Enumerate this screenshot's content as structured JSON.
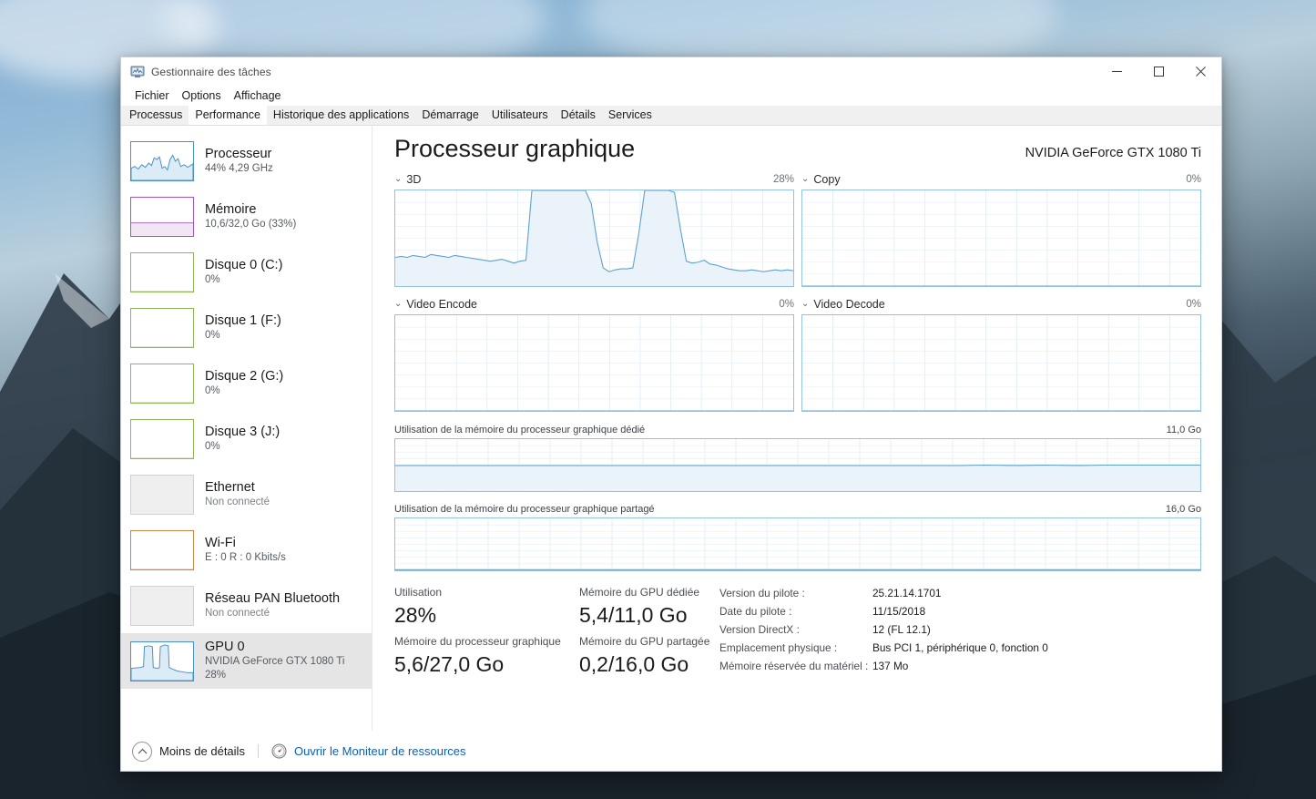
{
  "window": {
    "title": "Gestionnaire des tâches",
    "icon": "task-manager-icon",
    "minimize": "—",
    "maximize": "□",
    "close": "✕"
  },
  "menu": {
    "items": [
      "Fichier",
      "Options",
      "Affichage"
    ]
  },
  "tabs": {
    "items": [
      {
        "label": "Processus",
        "active": false
      },
      {
        "label": "Performance",
        "active": true
      },
      {
        "label": "Historique des applications",
        "active": false
      },
      {
        "label": "Démarrage",
        "active": false
      },
      {
        "label": "Utilisateurs",
        "active": false
      },
      {
        "label": "Détails",
        "active": false
      },
      {
        "label": "Services",
        "active": false
      }
    ]
  },
  "sidebar": {
    "items": [
      {
        "title": "Processeur",
        "sub": "44%  4,29 GHz",
        "accent": "#4a90c4",
        "fill": "#dcecf7",
        "type": "cpu",
        "selected": false,
        "empty": false
      },
      {
        "title": "Mémoire",
        "sub": "10,6/32,0 Go (33%)",
        "accent": "#a357b8",
        "fill": "#f0e6f4",
        "type": "mem",
        "selected": false,
        "empty": false
      },
      {
        "title": "Disque 0 (C:)",
        "sub": "0%",
        "accent": "#8cb85a",
        "fill": "#ffffff",
        "type": "disk",
        "selected": false,
        "empty": true
      },
      {
        "title": "Disque 1 (F:)",
        "sub": "0%",
        "accent": "#8cb85a",
        "fill": "#ffffff",
        "type": "disk",
        "selected": false,
        "empty": true
      },
      {
        "title": "Disque 2 (G:)",
        "sub": "0%",
        "accent": "#8cb85a",
        "fill": "#ffffff",
        "type": "disk",
        "selected": false,
        "empty": true
      },
      {
        "title": "Disque 3 (J:)",
        "sub": "0%",
        "accent": "#8cb85a",
        "fill": "#ffffff",
        "type": "disk",
        "selected": false,
        "empty": true
      },
      {
        "title": "Ethernet",
        "sub": "Non connecté",
        "accent": "#d0d0d0",
        "fill": "#efefef",
        "type": "net-off",
        "selected": false,
        "empty": true
      },
      {
        "title": "Wi-Fi",
        "sub": "E : 0  R : 0 Kbits/s",
        "accent": "#c9884a",
        "fill": "#ffffff",
        "type": "net",
        "selected": false,
        "empty": true
      },
      {
        "title": "Réseau PAN Bluetooth",
        "sub": "Non connecté",
        "accent": "#d0d0d0",
        "fill": "#efefef",
        "type": "net-off",
        "selected": false,
        "empty": true
      },
      {
        "title": "GPU 0",
        "sub": "NVIDIA GeForce GTX 1080 Ti",
        "sub2": "28%",
        "accent": "#4a90c4",
        "fill": "#dcecf7",
        "type": "gpu",
        "selected": true,
        "empty": false
      }
    ]
  },
  "main": {
    "title": "Processeur graphique",
    "device": "NVIDIA GeForce GTX 1080 Ti",
    "engines": [
      {
        "name": "3D",
        "value": "28%"
      },
      {
        "name": "Copy",
        "value": "0%"
      },
      {
        "name": "Video Encode",
        "value": "0%"
      },
      {
        "name": "Video Decode",
        "value": "0%"
      }
    ],
    "memory_graphs": [
      {
        "label": "Utilisation de la mémoire du processeur graphique dédié",
        "max": "11,0 Go"
      },
      {
        "label": "Utilisation de la mémoire du processeur graphique partagé",
        "max": "16,0 Go"
      }
    ],
    "stats": [
      {
        "key": "Utilisation",
        "value": "28%"
      },
      {
        "key": "Mémoire du processeur graphique",
        "value": "5,6/27,0 Go"
      },
      {
        "key": "Mémoire du GPU dédiée",
        "value": "5,4/11,0 Go"
      },
      {
        "key": "Mémoire du GPU partagée",
        "value": "0,2/16,0 Go"
      }
    ],
    "info": [
      {
        "key": "Version du pilote :",
        "value": "25.21.14.1701"
      },
      {
        "key": "Date du pilote :",
        "value": "11/15/2018"
      },
      {
        "key": "Version DirectX :",
        "value": "12 (FL 12.1)"
      },
      {
        "key": "Emplacement physique :",
        "value": "Bus PCI 1, périphérique 0, fonction 0"
      },
      {
        "key": "Mémoire réservée du matériel :",
        "value": "137 Mo"
      }
    ]
  },
  "footer": {
    "less_details": "Moins de détails",
    "resource_monitor": "Ouvrir le Moniteur de ressources"
  },
  "chart_data": [
    {
      "type": "area",
      "title": "3D",
      "ylabel": "%",
      "ylim": [
        0,
        100
      ],
      "current": 28,
      "grid": true,
      "series": [
        {
          "name": "3D utilization",
          "values": [
            30,
            31,
            30,
            32,
            31,
            30,
            33,
            32,
            31,
            30,
            32,
            31,
            30,
            29,
            28,
            27,
            26,
            27,
            28,
            26,
            24,
            26,
            27,
            100,
            100,
            100,
            100,
            100,
            100,
            100,
            100,
            100,
            100,
            86,
            46,
            19,
            15,
            17,
            18,
            18,
            19,
            55,
            100,
            100,
            100,
            100,
            100,
            98,
            60,
            26,
            24,
            25,
            27,
            23,
            22,
            20,
            18,
            17,
            16,
            16,
            17,
            16,
            15,
            16,
            17,
            16,
            17,
            16
          ]
        }
      ]
    },
    {
      "type": "area",
      "title": "Copy",
      "ylim": [
        0,
        100
      ],
      "current": 0,
      "grid": true,
      "series": [
        {
          "name": "Copy utilization",
          "values": [
            0,
            0,
            0,
            0,
            0,
            0,
            0,
            0,
            0,
            0,
            0,
            0,
            0,
            0,
            0,
            0,
            0,
            0,
            0,
            0
          ]
        }
      ]
    },
    {
      "type": "area",
      "title": "Video Encode",
      "ylim": [
        0,
        100
      ],
      "current": 0,
      "grid": true,
      "series": [
        {
          "name": "Video Encode utilization",
          "values": [
            0,
            0,
            0,
            0,
            0,
            0,
            0,
            0,
            0,
            0,
            0,
            0,
            0,
            0,
            0,
            0,
            0,
            0,
            0,
            0
          ]
        }
      ]
    },
    {
      "type": "area",
      "title": "Video Decode",
      "ylim": [
        0,
        100
      ],
      "current": 0,
      "grid": true,
      "series": [
        {
          "name": "Video Decode utilization",
          "values": [
            0,
            0,
            0,
            0,
            0,
            0,
            0,
            0,
            0,
            0,
            0,
            0,
            0,
            0,
            0,
            0,
            0,
            0,
            0,
            0
          ]
        }
      ]
    },
    {
      "type": "area",
      "title": "Utilisation de la mémoire du processeur graphique dédié",
      "ylim": [
        0,
        11.0
      ],
      "ylabel": "Go",
      "current": 5.4,
      "grid": true,
      "series": [
        {
          "name": "Dedicated GPU memory",
          "values": [
            5.4,
            5.4,
            5.4,
            5.4,
            5.4,
            5.4,
            5.4,
            5.4,
            5.4,
            5.4,
            5.4,
            5.4,
            5.4,
            5.4,
            5.4,
            5.4,
            5.4,
            5.4,
            5.4,
            5.4,
            5.4,
            5.4,
            5.4,
            5.4,
            5.4,
            5.4,
            5.4,
            5.4,
            5.4,
            5.4,
            5.4,
            5.4,
            5.4,
            5.4,
            5.4,
            5.4,
            5.4,
            5.4,
            5.4,
            5.4,
            5.4,
            5.4,
            5.4,
            5.4,
            5.4,
            5.4,
            5.4,
            5.4,
            5.45,
            5.5,
            5.48,
            5.44,
            5.42,
            5.46,
            5.5,
            5.48,
            5.44,
            5.42,
            5.45,
            5.5,
            5.5,
            5.5,
            5.5,
            5.5,
            5.5,
            5.5,
            5.5,
            5.5
          ]
        }
      ]
    },
    {
      "type": "area",
      "title": "Utilisation de la mémoire du processeur graphique partagé",
      "ylim": [
        0,
        16.0
      ],
      "ylabel": "Go",
      "current": 0.2,
      "grid": true,
      "series": [
        {
          "name": "Shared GPU memory",
          "values": [
            0.2,
            0.2,
            0.2,
            0.2,
            0.2,
            0.2,
            0.2,
            0.2,
            0.2,
            0.2,
            0.2,
            0.2,
            0.2,
            0.2,
            0.2,
            0.2,
            0.2,
            0.2,
            0.2,
            0.2
          ]
        }
      ]
    }
  ]
}
